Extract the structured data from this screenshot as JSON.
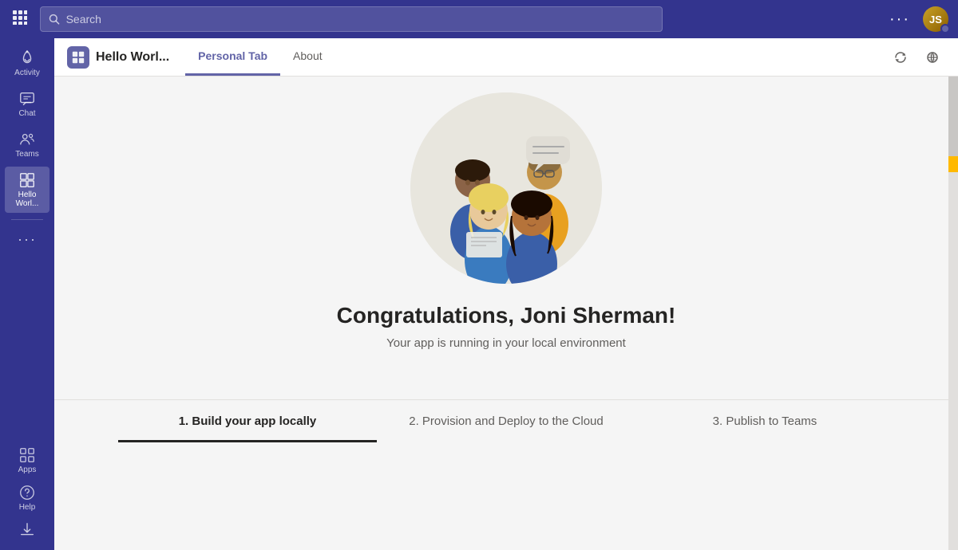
{
  "topbar": {
    "search_placeholder": "Search",
    "ellipsis_label": "···",
    "avatar_initials": "JS"
  },
  "sidebar": {
    "items": [
      {
        "id": "activity",
        "label": "Activity",
        "active": false
      },
      {
        "id": "chat",
        "label": "Chat",
        "active": false
      },
      {
        "id": "teams",
        "label": "Teams",
        "active": false
      },
      {
        "id": "hello-world",
        "label": "Hello Worl...",
        "active": true
      }
    ],
    "bottom_items": [
      {
        "id": "more",
        "label": "···"
      },
      {
        "id": "apps",
        "label": "Apps"
      },
      {
        "id": "help",
        "label": "Help"
      },
      {
        "id": "download",
        "label": ""
      }
    ]
  },
  "app_header": {
    "icon_label": "⊞",
    "title": "Hello Worl...",
    "tabs": [
      {
        "id": "personal-tab",
        "label": "Personal Tab",
        "active": true
      },
      {
        "id": "about",
        "label": "About",
        "active": false
      }
    ],
    "refresh_label": "↻",
    "globe_label": "⊕"
  },
  "hero": {
    "title": "Congratulations, Joni Sherman!",
    "subtitle": "Your app is running in your local environment"
  },
  "steps": [
    {
      "id": "step1",
      "label": "1. Build your app locally",
      "active": true
    },
    {
      "id": "step2",
      "label": "2. Provision and Deploy to the Cloud",
      "active": false
    },
    {
      "id": "step3",
      "label": "3. Publish to Teams",
      "active": false
    }
  ]
}
